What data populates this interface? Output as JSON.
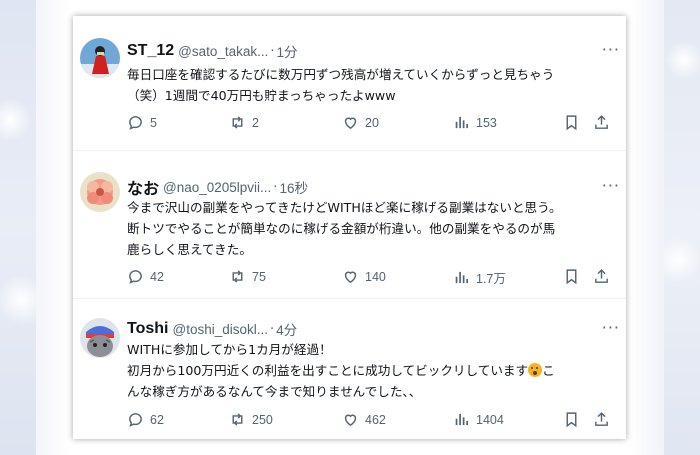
{
  "tweets": [
    {
      "name": "ST_12",
      "handle": "@sato_takak...",
      "time": "1分",
      "lines": [
        "毎日口座を確認するたびに数万円ずつ残高が増えていくからずっと見ちゃう",
        "（笑）1週間で40万円も貯まっちゃったよwww"
      ],
      "replies": "5",
      "retweets": "2",
      "likes": "20",
      "views": "153",
      "avatar_icon": "climber-avatar-icon"
    },
    {
      "name": "なお",
      "handle": "@nao_0205lpvii...",
      "time": "16秒",
      "lines": [
        "今まで沢山の副業をやってきたけどWITHほど楽に稼げる副業はないと思う。",
        "断トツでやることが簡単なのに稼げる金額が桁違い。他の副業をやるのが馬",
        "鹿らしく思えてきた。"
      ],
      "replies": "42",
      "retweets": "75",
      "likes": "140",
      "views": "1.7万",
      "avatar_icon": "flower-avatar-icon"
    },
    {
      "name": "Toshi",
      "handle": "@toshi_disokl...",
      "time": "4分",
      "lines": [
        "WITHに参加してから1カ月が経過！",
        "初月から100万円近くの利益を出すことに成功してビックリしています",
        "んな稼ぎ方があるなんて今まで知りませんでした、、"
      ],
      "line2_tail": "こ",
      "replies": "62",
      "retweets": "250",
      "likes": "462",
      "views": "1404",
      "avatar_icon": "cat-avatar-icon"
    }
  ],
  "separator_dot": "·",
  "more_label": "···",
  "colors": {
    "text": "#0f1419",
    "muted": "#536471",
    "border": "#eff3f4"
  }
}
